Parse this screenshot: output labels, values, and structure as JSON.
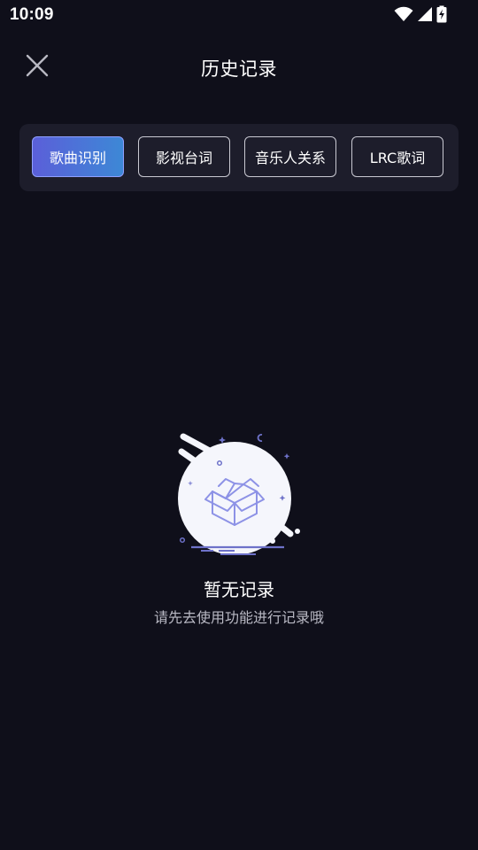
{
  "status_bar": {
    "time": "10:09",
    "icons": [
      "wifi-icon",
      "cellular-signal-icon",
      "battery-charging-icon"
    ]
  },
  "header": {
    "close_icon": "close-icon",
    "title": "历史记录"
  },
  "tabs": [
    {
      "label": "歌曲识别",
      "selected": true
    },
    {
      "label": "影视台词",
      "selected": false
    },
    {
      "label": "音乐人关系",
      "selected": false
    },
    {
      "label": "LRC歌词",
      "selected": false
    }
  ],
  "empty_state": {
    "illustration": "empty-box-icon",
    "title": "暂无记录",
    "subtitle": "请先去使用功能进行记录哦"
  },
  "colors": {
    "background": "#0f0f1a",
    "panel": "#1d1d2b",
    "accent_start": "#5b5fd9",
    "accent_end": "#3d88d6"
  }
}
